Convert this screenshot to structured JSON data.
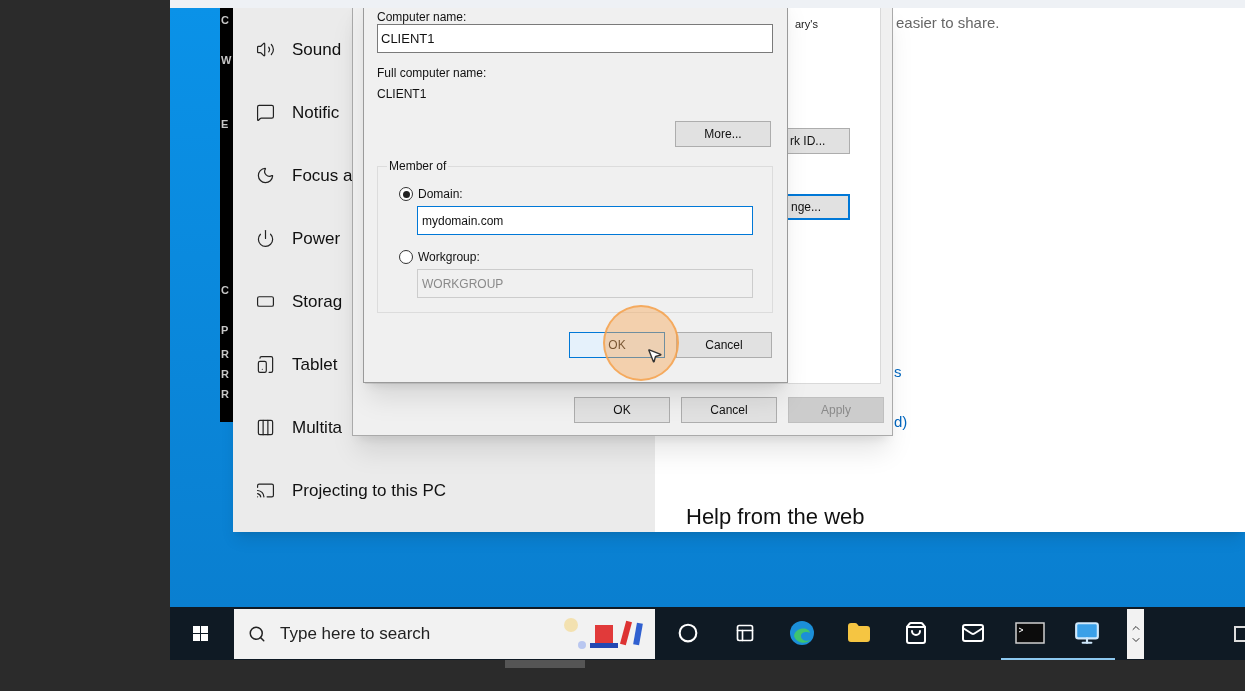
{
  "terminal_window": {
    "letters": [
      "C",
      "W",
      "E",
      "C",
      "P",
      "R",
      "R",
      "R"
    ]
  },
  "settings": {
    "nav_items": [
      {
        "label": "Sound"
      },
      {
        "label": "Notific"
      },
      {
        "label": "Focus a"
      },
      {
        "label": "Power"
      },
      {
        "label": "Storag"
      },
      {
        "label": "Tablet"
      },
      {
        "label": "Multita"
      },
      {
        "label": "Projecting to this PC"
      }
    ],
    "content": {
      "text_fragment": "easier to share.",
      "link_fragments": [
        "s",
        "d)"
      ],
      "heading": "Help from the web"
    }
  },
  "system_properties": {
    "text_fragment": "ary's",
    "partial_buttons": [
      {
        "label": "rk ID...",
        "focused": false
      },
      {
        "label": "nge...",
        "focused": true
      }
    ],
    "buttons": [
      {
        "label": "OK",
        "disabled": false
      },
      {
        "label": "Cancel",
        "disabled": false
      },
      {
        "label": "Apply",
        "disabled": true
      }
    ]
  },
  "computer_name_dialog": {
    "computer_name_label": "Computer name:",
    "computer_name": "CLIENT1",
    "full_name_label": "Full computer name:",
    "full_name": "CLIENT1",
    "more_button": "More...",
    "member_of": "Member of",
    "options": [
      {
        "label": "Domain:",
        "selected": true,
        "value": "mydomain.com"
      },
      {
        "label": "Workgroup:",
        "selected": false,
        "value": "WORKGROUP"
      }
    ],
    "buttons": [
      {
        "label": "OK",
        "default": true
      },
      {
        "label": "Cancel",
        "default": false
      }
    ]
  },
  "taskbar": {
    "search": {
      "placeholder": "Type here to search"
    },
    "apps": [
      {
        "kind": "cortana",
        "running": false
      },
      {
        "kind": "task-view",
        "running": false
      },
      {
        "kind": "edge",
        "running": false
      },
      {
        "kind": "explorer",
        "running": false
      },
      {
        "kind": "store",
        "running": false
      },
      {
        "kind": "mail",
        "running": false
      },
      {
        "kind": "terminal",
        "running": true
      },
      {
        "kind": "system",
        "running": true
      }
    ]
  }
}
